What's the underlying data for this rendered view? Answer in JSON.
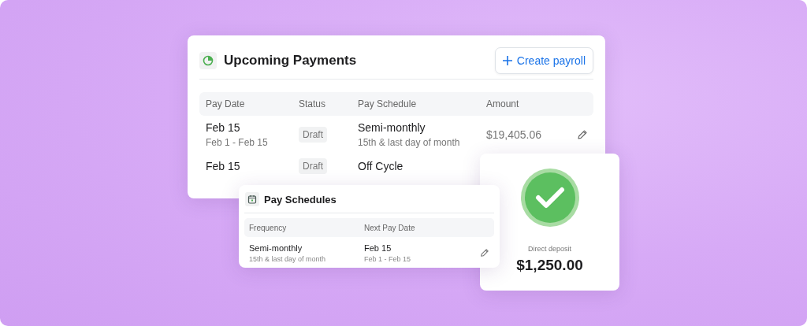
{
  "payments_card": {
    "title": "Upcoming Payments",
    "create_button": "Create payroll",
    "columns": [
      "Pay Date",
      "Status",
      "Pay Schedule",
      "Amount"
    ],
    "rows": [
      {
        "date": "Feb 15",
        "period": "Feb 1 - Feb 15",
        "status": "Draft",
        "schedule": "Semi-monthly",
        "schedule_detail": "15th & last day of month",
        "amount": "$19,405.06"
      },
      {
        "date": "Feb 15",
        "status": "Draft",
        "schedule": "Off Cycle"
      }
    ]
  },
  "schedules_card": {
    "title": "Pay Schedules",
    "columns": [
      "Frequency",
      "Next Pay Date"
    ],
    "rows": [
      {
        "frequency": "Semi-monthly",
        "frequency_detail": "15th & last day of month",
        "next_date": "Feb 15",
        "period": "Feb 1 - Feb 15"
      }
    ]
  },
  "deposit_card": {
    "label": "Direct deposit",
    "amount": "$1,250.00"
  }
}
